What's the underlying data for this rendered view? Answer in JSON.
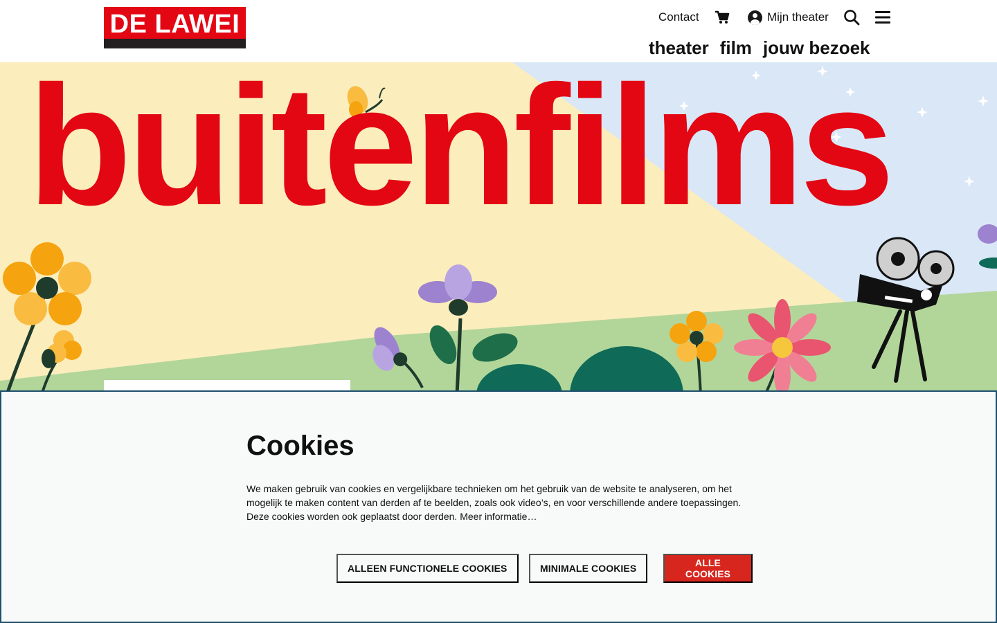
{
  "header": {
    "logo_text": "DE LAWEI",
    "util": {
      "contact": "Contact",
      "cart_icon": "cart-icon",
      "account_label": "Mijn theater",
      "search_icon": "search-icon",
      "menu_icon": "menu-icon"
    },
    "nav": [
      "theater",
      "film",
      "jouw bezoek"
    ]
  },
  "hero": {
    "title": "buitenfilms"
  },
  "cookie": {
    "title": "Cookies",
    "text": "We maken gebruik van cookies en vergelijkbare technieken om het gebruik van de website te analyseren, om het mogelijk te maken content van derden af te beelden, zoals ook video’s, en voor verschillende andere toepassingen. Deze cookies worden ook geplaatst door derden.",
    "more_link": "Meer informatie…",
    "buttons": {
      "functional": "ALLEEN FUNCTIONELE COOKIES",
      "minimal": "MINIMALE COOKIES",
      "all": "ALLE COOKIES"
    }
  },
  "colors": {
    "brand_red": "#e30613",
    "accept_button": "#d7261e",
    "hero_cream": "#fcedbd",
    "hero_sky": "#d9e7f6",
    "hero_grass": "#b2d69a"
  }
}
